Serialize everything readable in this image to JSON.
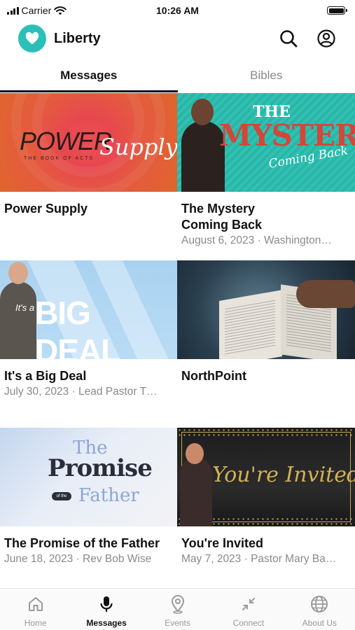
{
  "status_bar": {
    "carrier": "Carrier",
    "time": "10:26 AM"
  },
  "header": {
    "title": "Liberty",
    "logo_icon": "heart-icon",
    "brand_color": "#2bbfb8"
  },
  "tabs": [
    {
      "label": "Messages",
      "active": true
    },
    {
      "label": "Bibles",
      "active": false
    }
  ],
  "cards": [
    {
      "title": "Power Supply",
      "meta": "",
      "thumb": {
        "line1": "POWER",
        "line2": "Supply",
        "sub": "THE BOOK OF ACTS"
      }
    },
    {
      "title": "The Mystery\nComing Back",
      "meta": "August 6, 2023 · Washington…",
      "thumb": {
        "line1": "THE",
        "line2": "MYSTERY",
        "sub": "Coming Back"
      }
    },
    {
      "title": "It's a Big Deal",
      "meta": "July 30, 2023 · Lead Pastor T…",
      "thumb": {
        "line1": "It's a",
        "line2": "BIG DEAL"
      }
    },
    {
      "title": "NorthPoint",
      "meta": "",
      "thumb": {}
    },
    {
      "title": "The Promise of the Father",
      "meta": "June 18, 2023 · Rev Bob Wise",
      "thumb": {
        "line1": "The",
        "line2": "Promise",
        "of": "of the",
        "line3": "Father"
      }
    },
    {
      "title": "You're Invited",
      "meta": "May 7, 2023 · Pastor Mary Ba…",
      "thumb": {
        "line1": "You're Invited"
      }
    }
  ],
  "bottom_nav": [
    {
      "label": "Home",
      "icon": "home-icon",
      "active": false
    },
    {
      "label": "Messages",
      "icon": "microphone-icon",
      "active": true
    },
    {
      "label": "Events",
      "icon": "map-pin-icon",
      "active": false
    },
    {
      "label": "Connect",
      "icon": "arrows-collapse-icon",
      "active": false
    },
    {
      "label": "About Us",
      "icon": "globe-icon",
      "active": false
    }
  ]
}
